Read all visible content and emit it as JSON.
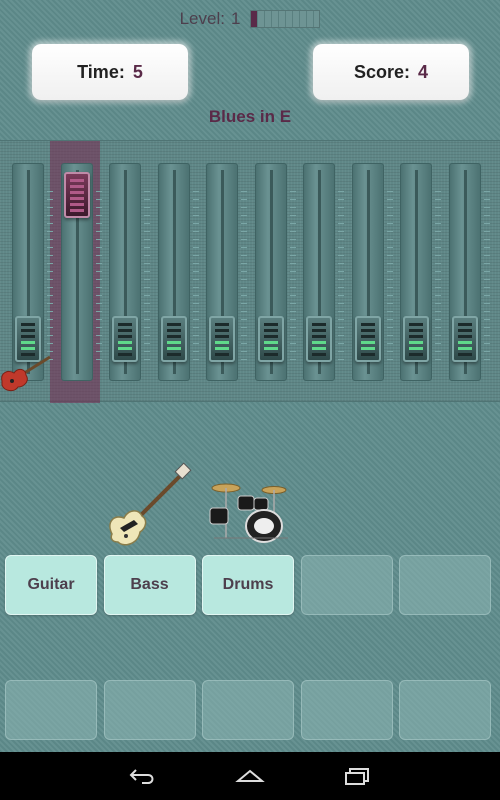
{
  "header": {
    "level_label": "Level:",
    "level_value": "1",
    "level_progress": 0.1
  },
  "stats": {
    "time_label": "Time:",
    "time_value": "5",
    "score_label": "Score:",
    "score_value": "4"
  },
  "song": {
    "title": "Blues in E"
  },
  "mixer": {
    "tracks": 10,
    "active_track_index": 1,
    "icons": [
      "fader-icon",
      "electric-guitar-icon"
    ]
  },
  "instruments": {
    "shown": [
      "bass-guitar-icon",
      "drum-kit-icon"
    ]
  },
  "slots": {
    "row1": [
      {
        "label": "Guitar",
        "filled": true
      },
      {
        "label": "Bass",
        "filled": true
      },
      {
        "label": "Drums",
        "filled": true
      },
      {
        "label": "",
        "filled": false
      },
      {
        "label": "",
        "filled": false
      }
    ],
    "row2": [
      {
        "label": "",
        "filled": false
      },
      {
        "label": "",
        "filled": false
      },
      {
        "label": "",
        "filled": false
      },
      {
        "label": "",
        "filled": false
      },
      {
        "label": "",
        "filled": false
      }
    ]
  },
  "navbar": {
    "buttons": [
      "back-icon",
      "home-icon",
      "recent-apps-icon"
    ]
  },
  "colors": {
    "background": "#5f8c8c",
    "accent": "#5a2a48",
    "slot_filled": "#b8e8df"
  }
}
